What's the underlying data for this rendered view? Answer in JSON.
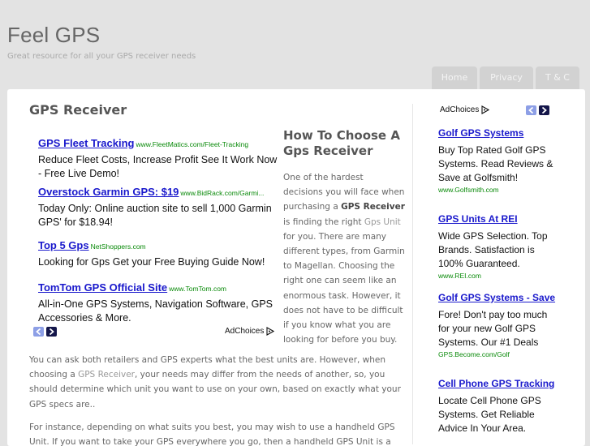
{
  "site": {
    "title": "Feel GPS",
    "tagline": "Great resource for all your GPS receiver needs"
  },
  "nav": [
    {
      "label": "Home"
    },
    {
      "label": "Privacy"
    },
    {
      "label": "T & C"
    }
  ],
  "post": {
    "title": "GPS Receiver",
    "paragraphs": [
      {
        "pre": "You can ask both retailers and GPS experts what the best units are. However, when choosing a ",
        "link": "GPS Receiver",
        "post": ", your needs may differ from the needs of another, so, you should determine which unit you want to use on your own, based on exactly what your GPS specs are.."
      },
      {
        "pre": "For instance, depending on what suits you best, you may wish to use a handheld GPS Unit. If you want to take your GPS everywhere you go, then a handheld GPS Unit is a great option"
      }
    ]
  },
  "ads_main": {
    "items": [
      {
        "title": "GPS Fleet Tracking",
        "url": "www.FleetMatics.com/Fleet-Tracking",
        "text": "Reduce Fleet Costs, Increase Profit See It Work Now - Free Live Demo!"
      },
      {
        "title": "Overstock Garmin GPS: $19",
        "url": "www.BidRack.com/Garmi...",
        "text": "Today Only: Online auction site to sell 1,000 Garmin GPS' for $18.94!"
      },
      {
        "title": "Top 5 Gps",
        "url": "NetShoppers.com",
        "text": "Looking for Gps Get your Free Buying Guide Now!"
      },
      {
        "title": "TomTom GPS Official Site",
        "url": "www.TomTom.com",
        "text": "All-in-One GPS Systems, Navigation Software, GPS Accessories & More."
      }
    ],
    "adchoices_label": "AdChoices"
  },
  "article_side": {
    "heading": "How To Choose A Gps Receiver",
    "text_pre": "One of the hardest decisions you will face when purchasing a ",
    "bold": "GPS Receiver",
    "text_mid": " is finding the right ",
    "link": "Gps Unit",
    "text_post": " for you. There are many different types, from Garmin to Magellan. Choosing the right one can seem like an enormous task. However, it does not have to be difficult if you know what you are looking for before you buy."
  },
  "ads_sidebar": {
    "adchoices_label": "AdChoices",
    "items": [
      {
        "title": "Golf GPS Systems",
        "text": "Buy Top Rated Golf GPS Systems. Read Reviews & Save at Golfsmith!",
        "url": "www.Golfsmith.com"
      },
      {
        "title": "GPS Units At REI",
        "text": "Wide GPS Selection. Top Brands. Satisfaction is 100% Guaranteed.",
        "url": "www.REI.com"
      },
      {
        "title": "Golf GPS Systems - Save",
        "text": "Fore! Don't pay too much for your new Golf GPS Systems. Our #1 Deals",
        "url": "GPS.Become.com/Golf"
      },
      {
        "title": "Cell Phone GPS Tracking",
        "text": "Locate Cell Phone GPS Systems. Get Reliable Advice In Your Area.",
        "url": ""
      }
    ]
  },
  "colors": {
    "ad_link": "#1a19cc",
    "ad_url": "#0a8a0a",
    "arrow_prev": "#8d9fe6",
    "arrow_next": "#14164a",
    "page_bg": "#e3e3e3"
  }
}
